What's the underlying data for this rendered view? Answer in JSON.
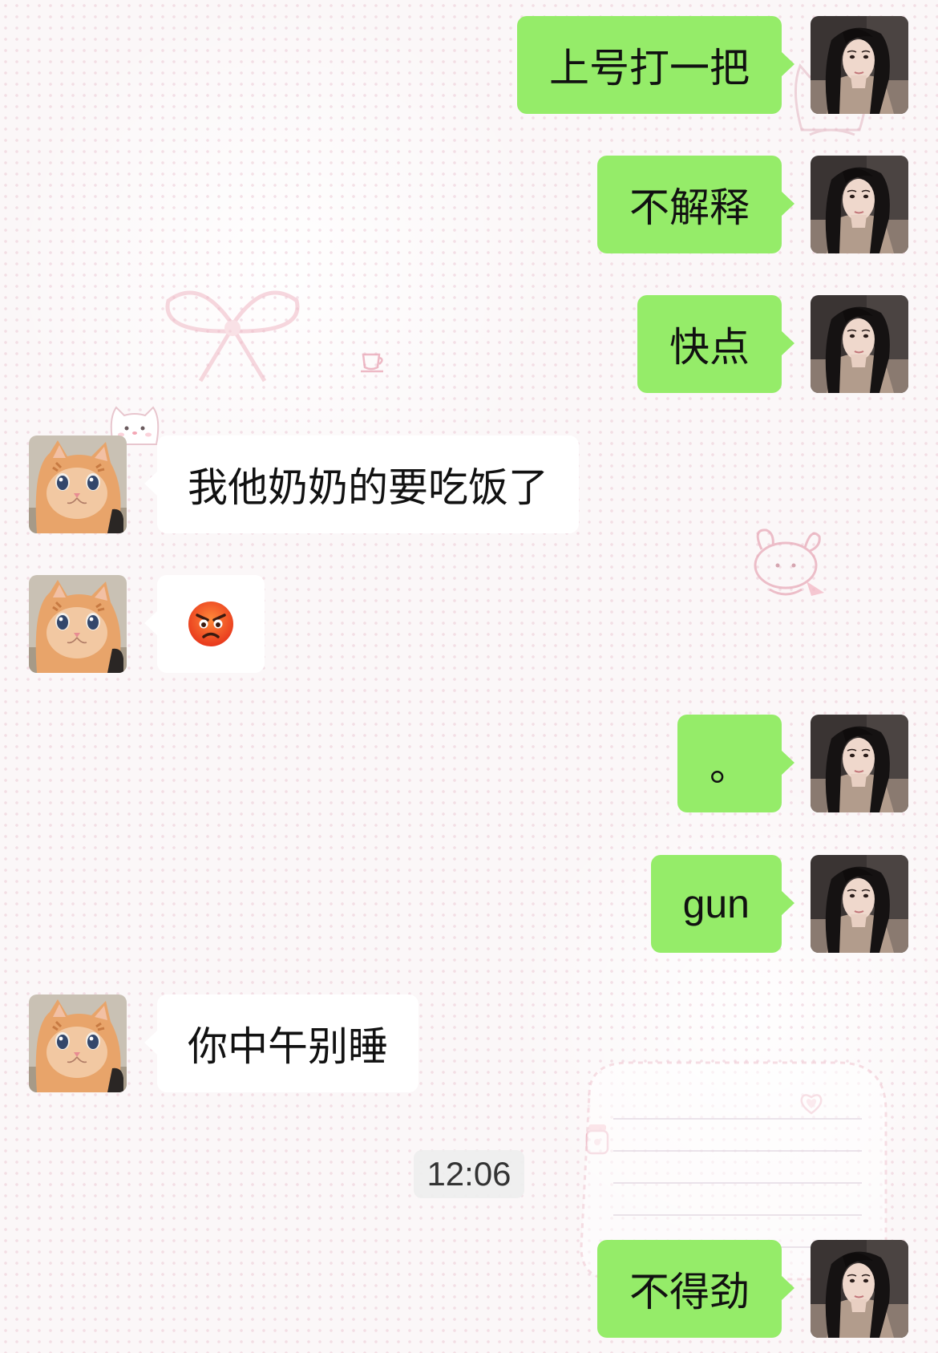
{
  "conversation": {
    "messages": [
      {
        "sender": "me",
        "text": "上号打一把"
      },
      {
        "sender": "me",
        "text": "不解释"
      },
      {
        "sender": "me",
        "text": "快点"
      },
      {
        "sender": "friend",
        "text": "我他奶奶的要吃饭了"
      },
      {
        "sender": "friend",
        "emoji": "angry-face-emoji"
      },
      {
        "sender": "me",
        "text": "。"
      },
      {
        "sender": "me",
        "text": "gun"
      },
      {
        "sender": "friend",
        "text": "你中午别睡"
      },
      {
        "sender": "me",
        "text": "不得劲"
      }
    ],
    "timestamp": "12:06"
  },
  "avatars": {
    "me": "girl-portrait-avatar",
    "friend": "kitten-avatar"
  },
  "colors": {
    "sent_bubble": "#95ec69",
    "received_bubble": "#ffffff",
    "text": "#111111",
    "timestamp_bg": "#eeeeee"
  }
}
